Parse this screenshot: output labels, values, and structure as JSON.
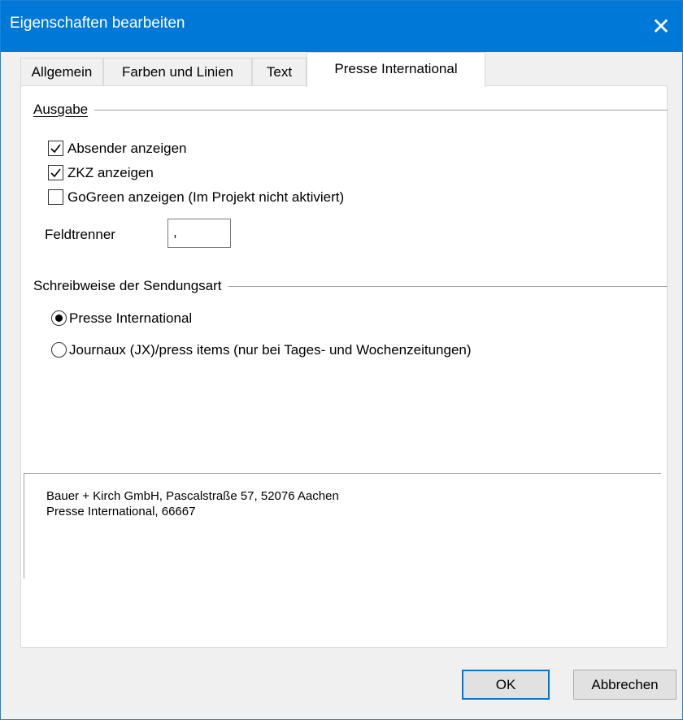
{
  "window": {
    "title": "Eigenschaften bearbeiten",
    "close_symbol": "✕"
  },
  "tabs": [
    {
      "label": "Allgemein",
      "active": false
    },
    {
      "label": "Farben und Linien",
      "active": false
    },
    {
      "label": "Text",
      "active": false
    },
    {
      "label": "Presse International",
      "active": true
    }
  ],
  "ausgabe": {
    "group_label": "Ausgabe",
    "options": [
      {
        "label": "Absender anzeigen",
        "checked": true
      },
      {
        "label": "ZKZ anzeigen",
        "checked": true
      },
      {
        "label": "GoGreen anzeigen (Im Projekt nicht aktiviert)",
        "checked": false
      }
    ],
    "feldtrenner": {
      "label": "Feldtrenner",
      "value": ","
    }
  },
  "schreibweise": {
    "group_label": "Schreibweise der Sendungsart",
    "options": [
      {
        "label": "Presse International",
        "selected": true
      },
      {
        "label": "Journaux (JX)/press items (nur bei Tages- und Wochenzeitungen)",
        "selected": false
      }
    ]
  },
  "preview": {
    "lines": [
      "Bauer + Kirch GmbH, Pascalstraße 57, 52076 Aachen",
      "Presse International, 66667"
    ]
  },
  "buttons": {
    "ok": "OK",
    "cancel": "Abbrechen"
  },
  "colors": {
    "titlebar": "#0078d7",
    "default_button_border": "#0078d7"
  }
}
